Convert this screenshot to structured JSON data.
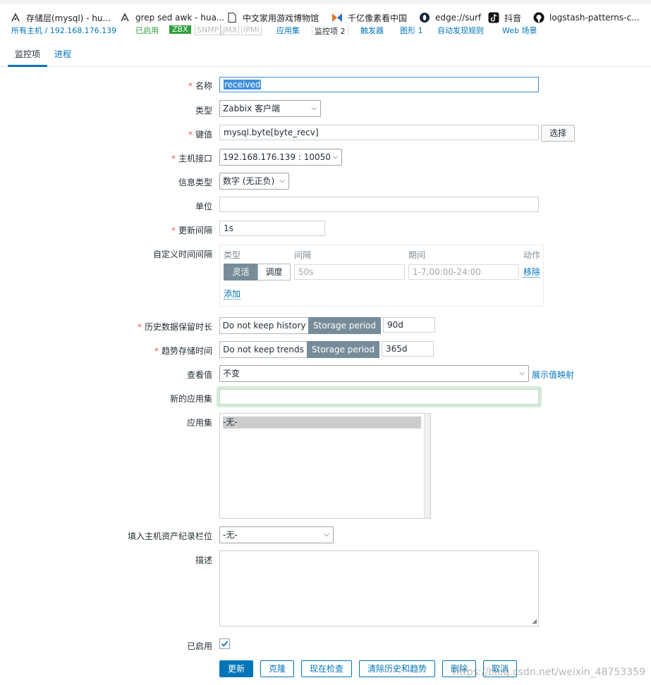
{
  "bookmarks": [
    {
      "icon": "ai-icon",
      "label": "存储层(mysql) - hu..."
    },
    {
      "icon": "ai-icon",
      "label": "grep sed awk - hua..."
    },
    {
      "icon": "document-icon",
      "label": "中文家用游戏博物馆"
    },
    {
      "icon": "bowtie-icon",
      "label": "千亿像素看中国"
    },
    {
      "icon": "edge-icon",
      "label": "edge://surf"
    },
    {
      "icon": "tiktok-icon",
      "label": "抖音"
    },
    {
      "icon": "github-icon",
      "label": "logstash-patterns-c..."
    }
  ],
  "breadcrumb": {
    "host": "所有主机 / 192.168.176.139",
    "enabled": "已启用",
    "zbx": "ZBX",
    "snmp": "SNMP",
    "jmx": "JMX",
    "ipmi": "IPMI",
    "apps": "应用集",
    "items": "监控项 2",
    "triggers": "触发器",
    "graphs": "图形 1",
    "discovery": "自动发现规则",
    "web": "Web 场景"
  },
  "tabs": [
    {
      "label": "监控项",
      "active": true
    },
    {
      "label": "进程",
      "active": false
    }
  ],
  "form": {
    "name": {
      "label": "名称",
      "value": "received"
    },
    "type": {
      "label": "类型",
      "value": "Zabbix 客户端"
    },
    "key": {
      "label": "键值",
      "value": "mysql.byte[byte_recv]",
      "button": "选择"
    },
    "interface": {
      "label": "主机接口",
      "value": "192.168.176.139 : 10050"
    },
    "info_type": {
      "label": "信息类型",
      "value": "数字 (无正负)"
    },
    "units": {
      "label": "单位",
      "value": ""
    },
    "update_interval": {
      "label": "更新间隔",
      "value": "1s"
    },
    "custom_intervals": {
      "label": "自定义时间间隔",
      "headers": {
        "type": "类型",
        "interval": "间隔",
        "period": "期间",
        "action": "动作"
      },
      "row": {
        "flexible": "灵活",
        "scheduling": "调度",
        "interval_placeholder": "50s",
        "period_placeholder": "1-7,00:00-24:00",
        "remove": "移除"
      },
      "add": "添加"
    },
    "history": {
      "label": "历史数据保留时长",
      "off_label": "Do not keep history",
      "on_label": "Storage period",
      "value": "90d"
    },
    "trends": {
      "label": "趋势存储时间",
      "off_label": "Do not keep trends",
      "on_label": "Storage period",
      "value": "365d"
    },
    "show_value": {
      "label": "查看值",
      "value": "不变",
      "link": "展示值映射"
    },
    "new_app": {
      "label": "新的应用集",
      "value": ""
    },
    "applications": {
      "label": "应用集",
      "options": [
        "-无-"
      ]
    },
    "inventory": {
      "label": "填入主机资产纪录栏位",
      "value": "-无-"
    },
    "description": {
      "label": "描述",
      "value": ""
    },
    "enabled": {
      "label": "已启用",
      "checked": true
    }
  },
  "actions": {
    "update": "更新",
    "clone": "克隆",
    "check_now": "现在检查",
    "clear": "清除历史和趋势",
    "delete": "删除",
    "cancel": "取消"
  },
  "watermark": "https://blog.csdn.net/weixin_48753359",
  "colors": {
    "accent": "#0275b8",
    "required": "#e45959",
    "segment_on": "#768d99"
  }
}
